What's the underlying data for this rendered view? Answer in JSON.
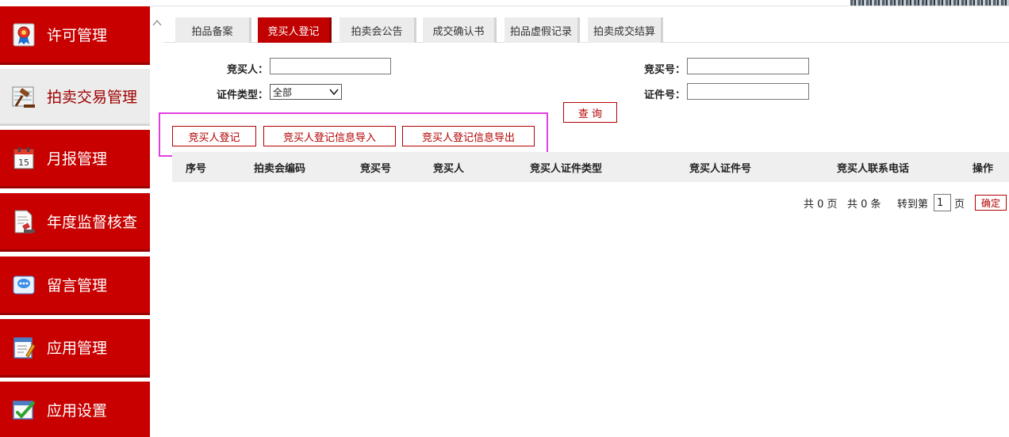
{
  "sidebar": {
    "items": [
      {
        "label": "许可管理",
        "icon": "award-ribbon-icon"
      },
      {
        "label": "拍卖交易管理",
        "icon": "gavel-icon"
      },
      {
        "label": "月报管理",
        "icon": "calendar-icon"
      },
      {
        "label": "年度监督核查",
        "icon": "document-stamp-icon"
      },
      {
        "label": "留言管理",
        "icon": "speech-bubble-icon"
      },
      {
        "label": "应用管理",
        "icon": "edit-form-icon"
      },
      {
        "label": "应用设置",
        "icon": "checklist-icon"
      }
    ],
    "active_index": 1,
    "calendar_day": "15"
  },
  "tabs": [
    {
      "label": "拍品备案"
    },
    {
      "label": "竞买人登记"
    },
    {
      "label": "拍卖会公告"
    },
    {
      "label": "成交确认书"
    },
    {
      "label": "拍品虚假记录"
    },
    {
      "label": "拍卖成交结算"
    }
  ],
  "form": {
    "bidder_label": "竞买人：",
    "bidder_value": "",
    "bid_no_label": "竞买号：",
    "bid_no_value": "",
    "id_type_label": "证件类型：",
    "id_type_selected": "全部",
    "id_no_label": "证件号：",
    "id_no_value": "",
    "query_button": "查 询"
  },
  "actions": {
    "register": "竞买人登记",
    "import": "竞买人登记信息导入",
    "export": "竞买人登记信息导出"
  },
  "table": {
    "columns": [
      "序号",
      "拍卖会编码",
      "竞买号",
      "竞买人",
      "竞买人证件类型",
      "竞买人证件号",
      "竞买人联系电话",
      "操作"
    ],
    "rows": []
  },
  "pager": {
    "total_pages": "共 0 页",
    "total_items": "共 0 条",
    "goto_prefix": "转到第",
    "page_value": "1",
    "goto_suffix": "页",
    "confirm": "确定"
  },
  "colors": {
    "primary_red": "#c80000",
    "highlight_magenta": "#e040e0"
  }
}
